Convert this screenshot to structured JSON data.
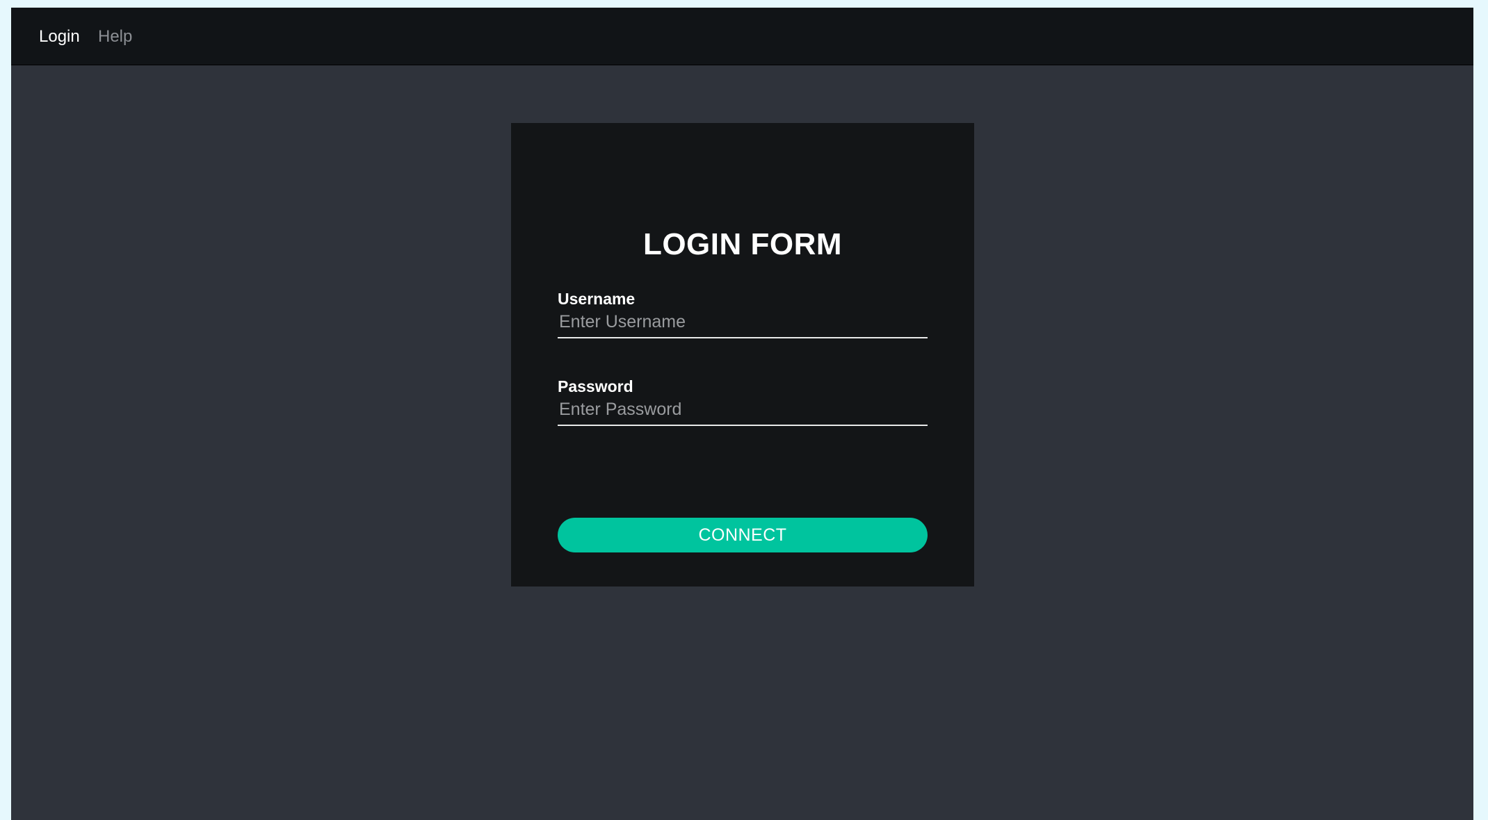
{
  "navbar": {
    "items": [
      {
        "label": "Login",
        "active": true
      },
      {
        "label": "Help",
        "active": false
      }
    ]
  },
  "form": {
    "title": "LOGIN FORM",
    "username": {
      "label": "Username",
      "value": "",
      "placeholder": "Enter Username"
    },
    "password": {
      "label": "Password",
      "value": "",
      "placeholder": "Enter Password"
    },
    "submit_label": "CONNECT"
  },
  "colors": {
    "page_background": "#2f333b",
    "navbar_background": "#111417",
    "card_background": "#131517",
    "accent": "#00c49e",
    "inactive_nav_text": "#8c8f94"
  }
}
